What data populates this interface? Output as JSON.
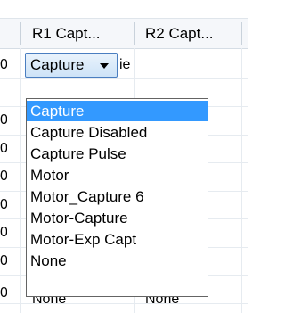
{
  "grid": {
    "columns": [
      "R1 Capt...",
      "R2 Capt..."
    ],
    "row_prefix": "0",
    "partial_cell_text": "ie",
    "bottom_row": [
      "None",
      "None"
    ]
  },
  "combo": {
    "value": "Capture"
  },
  "dropdown": {
    "options": [
      "Capture",
      "Capture Disabled",
      "Capture Pulse",
      "Motor",
      "Motor_Capture 6",
      "Motor-Capture",
      "Motor-Exp Capt",
      "None"
    ],
    "selected": "Capture"
  }
}
